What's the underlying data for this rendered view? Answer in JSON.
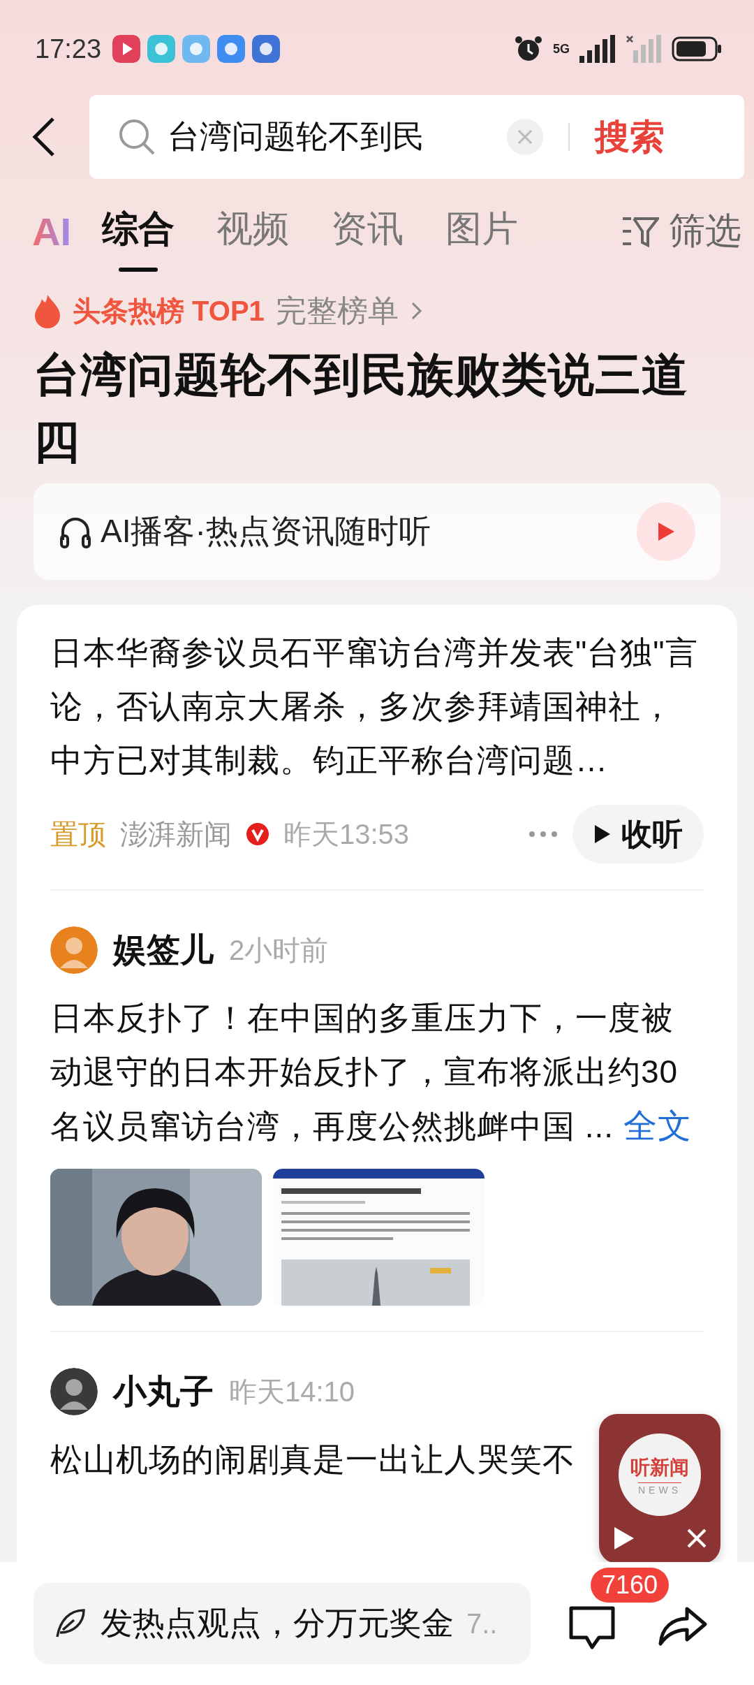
{
  "status_bar": {
    "time": "17:23",
    "network": "5G"
  },
  "search": {
    "value": "台湾问题轮不到民",
    "button": "搜索"
  },
  "tabs": [
    {
      "label": "综合",
      "selected": true
    },
    {
      "label": "视频",
      "selected": false
    },
    {
      "label": "资讯",
      "selected": false
    },
    {
      "label": "图片",
      "selected": false
    }
  ],
  "ai_label": "AI",
  "filter": "筛选",
  "hot": {
    "badge": "头条热榜 TOP1",
    "link": "完整榜单",
    "title": "台湾问题轮不到民族败类说三道四"
  },
  "podcast": {
    "label": "AI播客·热点资讯随时听"
  },
  "posts": [
    {
      "kind": "pinned",
      "text": "日本华裔参议员石平窜访台湾并发表\"台独\"言论，否认南京大屠杀，多次参拜靖国神社，中方已对其制裁。钧正平称台湾问题…",
      "tag": "置顶",
      "source": "澎湃新闻",
      "verified": true,
      "time": "昨天13:53",
      "listen": "收听"
    },
    {
      "kind": "user",
      "author": "娱签儿",
      "time": "2小时前",
      "text": "日本反扑了！在中国的多重压力下，一度被动退守的日本开始反扑了，宣布将派出约30名议员窜访台湾，再度公然挑衅中国 ...",
      "more": "全文"
    },
    {
      "kind": "user",
      "author": "小丸子",
      "time": "昨天14:10",
      "text": "松山机场的闹剧真是一出让人哭笑不"
    }
  ],
  "news_widget": {
    "title": "听新闻",
    "subtitle": "NEWS"
  },
  "bottom_bar": {
    "placeholder": "发热点观点，分万元奖金",
    "hint": "7..",
    "comment_count": "7160"
  }
}
